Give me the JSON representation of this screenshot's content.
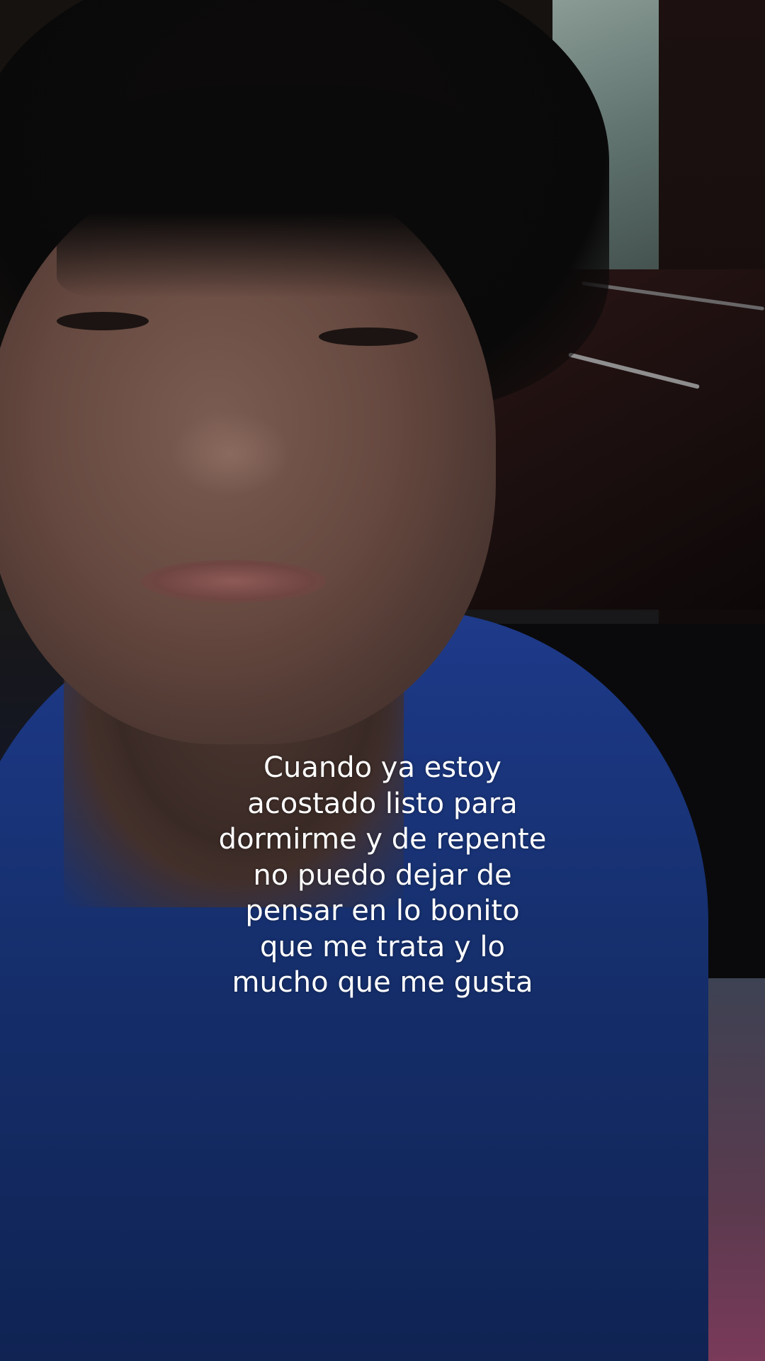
{
  "caption": {
    "lines": [
      "Cuando ya estoy",
      "acostado listo para",
      "dormirme y de repente",
      "no puedo dejar de",
      "pensar en lo bonito",
      "que me trata y lo",
      "mucho que me gusta"
    ]
  }
}
